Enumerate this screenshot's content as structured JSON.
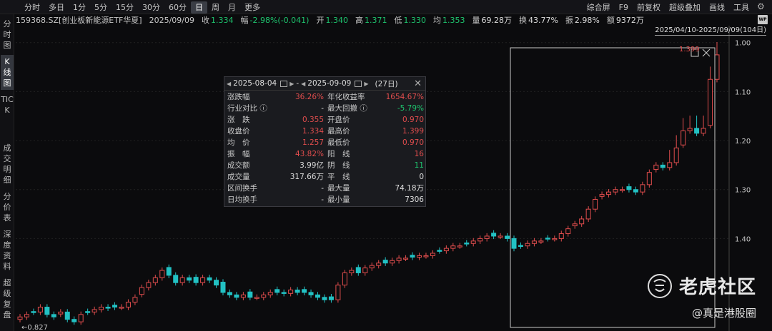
{
  "toolbar": {
    "periods": [
      "分时",
      "多日",
      "1分",
      "5分",
      "15分",
      "30分",
      "60分",
      "日",
      "周",
      "月",
      "更多"
    ],
    "active_period": "日",
    "tools": [
      "综合屏",
      "F9",
      "前复权",
      "超级叠加",
      "画线",
      "工具"
    ]
  },
  "info": {
    "code_name": "159368.SZ[创业板新能源ETF华夏]",
    "date": "2025/09/09",
    "close_label": "收",
    "close": "1.334",
    "change_label": "幅",
    "change": "-2.98%(-0.041)",
    "open_label": "开",
    "open": "1.340",
    "high_label": "高",
    "high": "1.371",
    "low_label": "低",
    "low": "1.330",
    "avg_label": "均",
    "avg": "1.353",
    "vol_label": "量",
    "vol": "69.28万",
    "turnover_label": "换",
    "turnover": "43.77%",
    "amp_label": "振",
    "amp": "2.98%",
    "amount_label": "额",
    "amount": "9372万",
    "wp_icon": "WP"
  },
  "side_tabs": [
    "分时图",
    "K线图",
    "TICK",
    "成交明细",
    "分价表",
    "深度资料",
    "超级复盘"
  ],
  "side_active": "K线图",
  "chart": {
    "range_label": "2025/04/10-2025/09/09(104日)",
    "yticks": [
      "1.40",
      "1.30",
      "1.20",
      "1.10",
      "1.00"
    ],
    "min_label": "←0.827",
    "max_label": "1.399",
    "up_color": "#e04d4d",
    "down_color": "#22c1c3"
  },
  "chart_data": {
    "type": "candlestick",
    "ylim": [
      0.82,
      1.42
    ],
    "yticks": [
      1.0,
      1.1,
      1.2,
      1.3,
      1.4
    ],
    "min_price": 0.827,
    "max_price": 1.399,
    "closes": [
      0.84,
      0.845,
      0.85,
      0.86,
      0.845,
      0.84,
      0.85,
      0.835,
      0.83,
      0.845,
      0.85,
      0.855,
      0.86,
      0.858,
      0.86,
      0.86,
      0.87,
      0.88,
      0.9,
      0.91,
      0.92,
      0.935,
      0.925,
      0.91,
      0.92,
      0.915,
      0.91,
      0.92,
      0.915,
      0.905,
      0.89,
      0.885,
      0.88,
      0.885,
      0.88,
      0.88,
      0.885,
      0.89,
      0.89,
      0.888,
      0.895,
      0.89,
      0.89,
      0.885,
      0.88,
      0.875,
      0.875,
      0.905,
      0.93,
      0.935,
      0.93,
      0.94,
      0.945,
      0.95,
      0.95,
      0.955,
      0.96,
      0.96,
      0.962,
      0.965,
      0.965,
      0.97,
      0.975,
      0.98,
      0.985,
      0.985,
      0.99,
      0.995,
      1.0,
      1.005,
      1.005,
      1.005,
      1.0,
      0.98,
      0.985,
      0.99,
      0.995,
      0.995,
      1.0,
      1.0,
      1.01,
      1.02,
      1.03,
      1.04,
      1.06,
      1.08,
      1.09,
      1.095,
      1.1,
      1.1,
      1.1,
      1.095,
      1.11,
      1.135,
      1.15,
      1.145,
      1.155,
      1.185,
      1.22,
      1.225,
      1.215,
      1.225,
      1.325,
      1.375
    ]
  },
  "stats": {
    "from": "2025-08-04",
    "dash": "-",
    "to": "2025-09-09",
    "days": "(27日)",
    "rows": [
      {
        "k1": "涨跌幅",
        "v1": "36.26%",
        "c1": "red",
        "k2": "年化收益率",
        "v2": "1654.67%",
        "c2": "red"
      },
      {
        "k1": "行业对比 ⓘ",
        "v1": "-",
        "c1": "white",
        "k2": "最大回撤 ⓘ",
        "v2": "-5.79%",
        "c2": "green"
      },
      {
        "k1": "涨　跌",
        "v1": "0.355",
        "c1": "red",
        "k2": "开盘价",
        "v2": "0.970",
        "c2": "red"
      },
      {
        "k1": "收盘价",
        "v1": "1.334",
        "c1": "red",
        "k2": "最高价",
        "v2": "1.399",
        "c2": "red"
      },
      {
        "k1": "均　价",
        "v1": "1.257",
        "c1": "red",
        "k2": "最低价",
        "v2": "0.970",
        "c2": "red"
      },
      {
        "k1": "振　幅",
        "v1": "43.82%",
        "c1": "red",
        "k2": "阳　线",
        "v2": "16",
        "c2": "red"
      },
      {
        "k1": "成交额",
        "v1": "3.99亿",
        "c1": "white",
        "k2": "阴　线",
        "v2": "11",
        "c2": "green"
      },
      {
        "k1": "成交量",
        "v1": "317.66万",
        "c1": "white",
        "k2": "平　线",
        "v2": "0",
        "c2": "white"
      },
      {
        "k1": "区间换手",
        "v1": "-",
        "c1": "white",
        "k2": "最大量",
        "v2": "74.18万",
        "c2": "white"
      },
      {
        "k1": "日均换手",
        "v1": "-",
        "c1": "white",
        "k2": "最小量",
        "v2": "7306",
        "c2": "white"
      }
    ]
  },
  "watermark": {
    "brand": "老虎社区",
    "credit": "@真是港股圈"
  }
}
